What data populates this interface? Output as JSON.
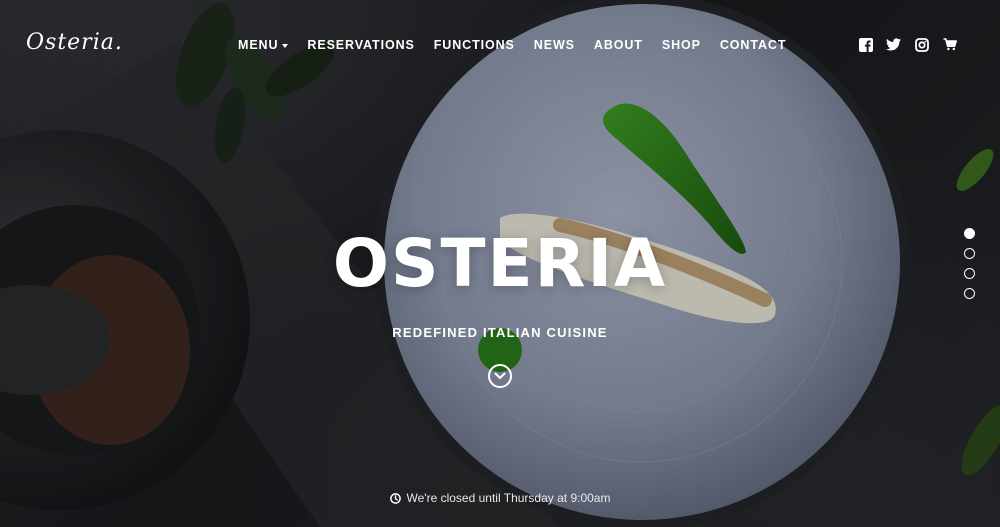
{
  "brand": {
    "logo_text": "Osteria."
  },
  "nav": {
    "items": [
      {
        "label": "MENU",
        "has_dropdown": true
      },
      {
        "label": "RESERVATIONS"
      },
      {
        "label": "FUNCTIONS"
      },
      {
        "label": "NEWS"
      },
      {
        "label": "ABOUT"
      },
      {
        "label": "SHOP"
      },
      {
        "label": "CONTACT"
      }
    ]
  },
  "social": [
    "facebook-icon",
    "twitter-icon",
    "instagram-icon",
    "cart-icon"
  ],
  "hero": {
    "title": "OSTERIA",
    "subtitle": "REDEFINED ITALIAN CUISINE",
    "scroll_icon": "chevron-down-icon"
  },
  "slider": {
    "count": 4,
    "active": 1
  },
  "status": {
    "text": "We're closed until Thursday at 9:00am",
    "icon": "clock-icon"
  },
  "colors": {
    "text": "#ffffff",
    "background": "#1c1d20",
    "plate": "#8e97ad",
    "herb": "#2f7d1c"
  }
}
